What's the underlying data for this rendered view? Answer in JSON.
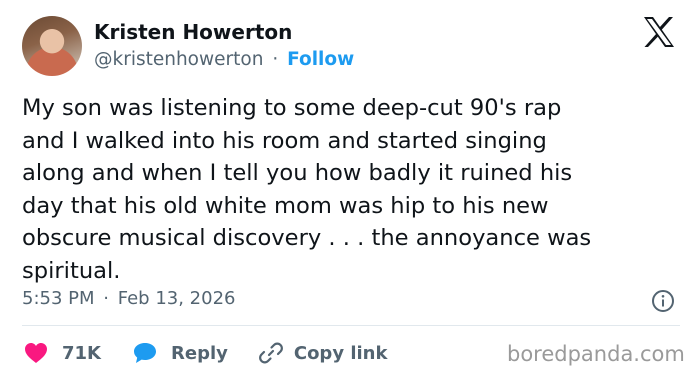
{
  "author": {
    "name": "Kristen Howerton",
    "handle": "@kristenhowerton",
    "separator": "·",
    "follow_label": "Follow"
  },
  "brand": {
    "icon": "x-logo-icon"
  },
  "tweet": {
    "lines": [
      "My son was listening to some deep-cut 90's rap",
      "and I walked into his room and started singing",
      "along and when I tell you how badly it ruined his",
      "day that his old white mom was hip to his new",
      "obscure musical discovery . . . the annoyance was",
      "spiritual."
    ]
  },
  "meta": {
    "time": "5:53 PM",
    "separator": "·",
    "date": "Feb 13, 2026"
  },
  "actions": {
    "like_count": "71K",
    "reply_label": "Reply",
    "copy_label": "Copy link"
  },
  "watermark": "boredpanda.com",
  "colors": {
    "accent": "#1d9bf0",
    "like": "#f91880",
    "text": "#0f1419",
    "secondary": "#536471"
  }
}
